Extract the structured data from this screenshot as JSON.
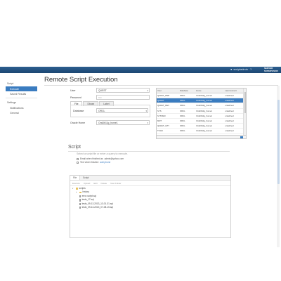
{
  "topbar": {
    "user": "scriptadmin",
    "help": "?",
    "logo_line1": "SERVER",
    "logo_line2": "SUPERVISOR"
  },
  "sidebar": {
    "group_script": "Script",
    "item_execute": "Execute",
    "item_saved": "Saved Results",
    "group_settings": "Settings",
    "item_notifications": "Notifications",
    "item_general": "General"
  },
  "main": {
    "title": "Remote Script Execution"
  },
  "form": {
    "user_label": "User",
    "user_value": "QUEST",
    "password_label": "Password",
    "password_placeholder": "••••",
    "tabs": [
      "File",
      "Dbase",
      "Label"
    ],
    "database_label": "Database",
    "database_value": "ORCL",
    "oracle_home_label": "Oracle Home",
    "oracle_home_value": "OraDb11g_home1"
  },
  "table": {
    "headers": [
      "User",
      "Database",
      "Home",
      "Last Connect"
    ],
    "rows": [
      [
        "QUEST_PMP",
        "ORCL",
        "OraDb11g_home1",
        "undefined"
      ],
      [
        "QUEST",
        "ORCL",
        "OraDb11g_home1",
        "undefined"
      ],
      [
        "QUEST_DEV",
        "ORCL",
        "OraDb11g_home1",
        "undefined"
      ],
      [
        "SYS",
        "ORCL",
        "OraDb11g_home1",
        "undefined"
      ],
      [
        "SYSTEM",
        "ORCL",
        "OraDb11g_home1",
        "undefined"
      ],
      [
        "MNT",
        "ORCL",
        "OraDb11g_home1",
        "undefined"
      ],
      [
        "QUEST_QTY",
        "ORCL",
        "OraDb11g_home1",
        "undefined"
      ],
      [
        "TOAD",
        "ORCL",
        "OraDb11g_home1",
        "undefined"
      ]
    ],
    "selected_index": 1
  },
  "script": {
    "title": "Script",
    "hint": "Select a script file or enter a query to execute.",
    "email_label": "Email when finished as",
    "email_value": "admin@yahoo.com",
    "text_label": "Text when finished",
    "text_link": "add phone"
  },
  "filebrowser": {
    "tabs": [
      "File",
      "Script"
    ],
    "toolbar": [
      "Execute",
      "Upload",
      "Edit",
      "Delete",
      "New Folder"
    ],
    "tree": [
      {
        "type": "folder",
        "depth": 0,
        "name": "scripts",
        "expanded": true
      },
      {
        "type": "folder",
        "depth": 1,
        "name": "history",
        "expanded": false
      },
      {
        "type": "file",
        "depth": 1,
        "name": "error-script.sql"
      },
      {
        "type": "file",
        "depth": 1,
        "name": "tests_17.sql"
      },
      {
        "type": "file",
        "depth": 1,
        "name": "tests_09-13-2013_13-01-31.sql"
      },
      {
        "type": "file",
        "depth": 1,
        "name": "tests_09-13-2013_07-08-15.sql"
      }
    ]
  }
}
